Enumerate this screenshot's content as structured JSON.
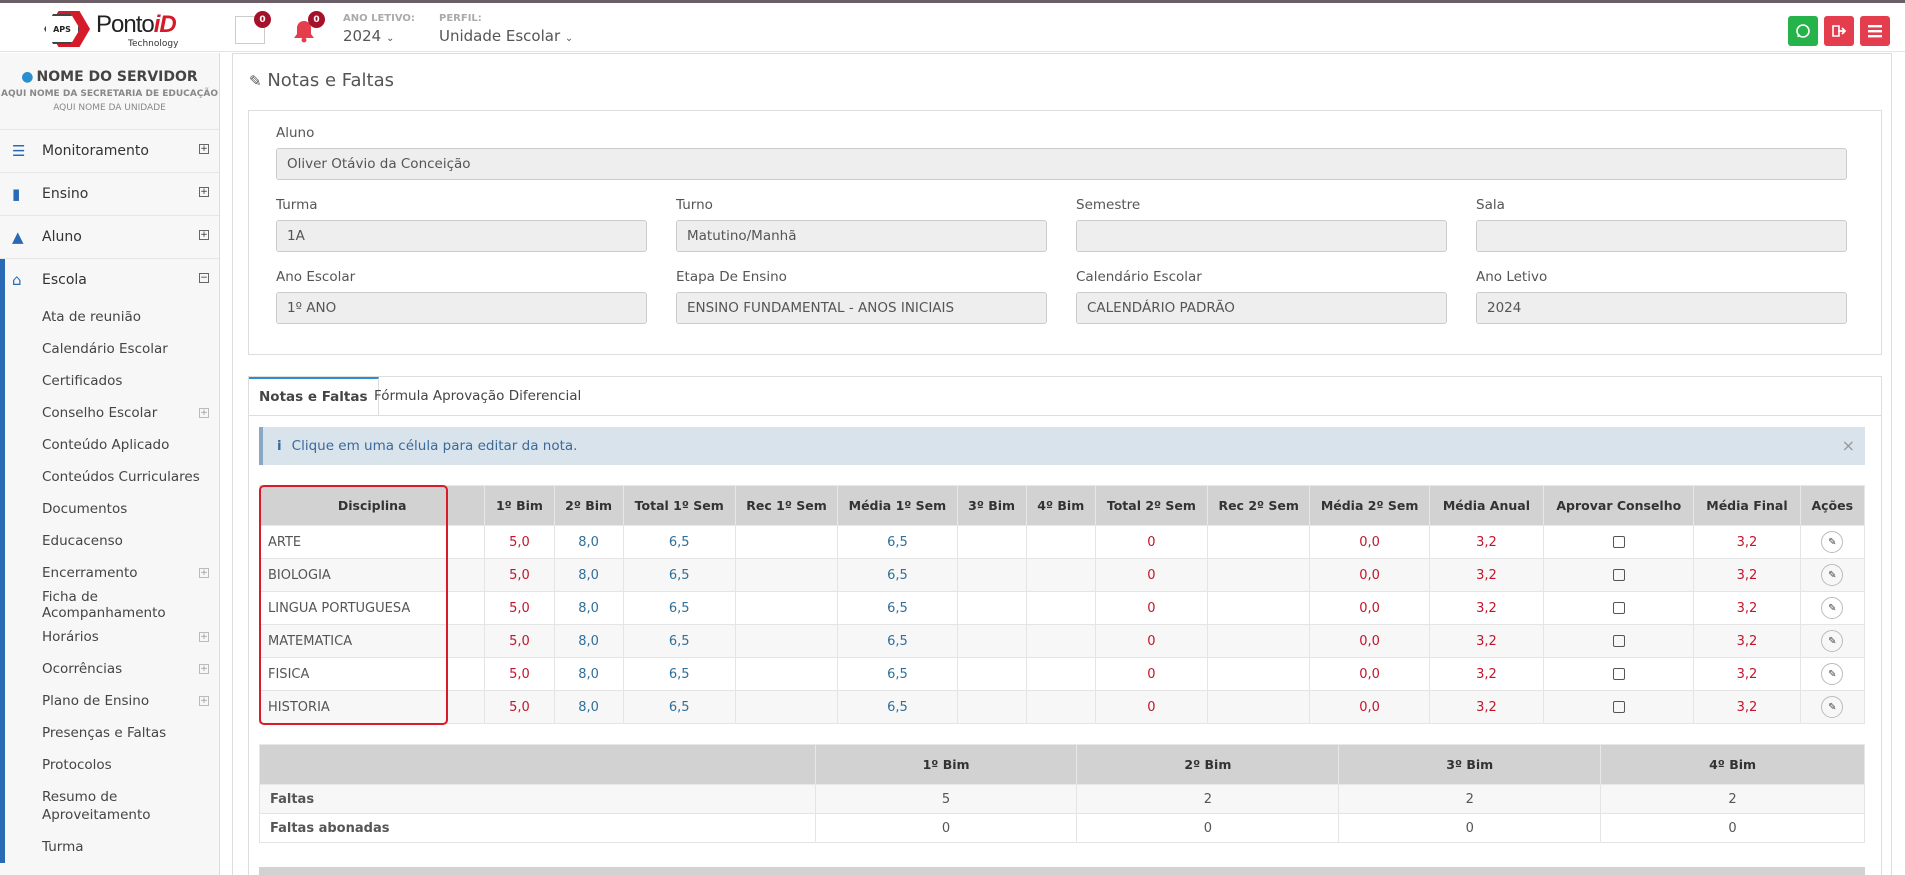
{
  "header": {
    "brand_pre": "Ponto",
    "brand_post": "iD",
    "brand_sub": "Technology",
    "logo_mark": "APS",
    "messages_count": "0",
    "notifications_count": "0",
    "ano_label": "ANO LETIVO:",
    "ano_value": "2024",
    "perfil_label": "PERFIL:",
    "perfil_value": "Unidade Escolar",
    "colors": {
      "whatsapp": "#25b34a",
      "logout": "#e33d4e",
      "menu": "#e33d4e"
    }
  },
  "sidebar": {
    "user_name": "NOME DO SERVIDOR",
    "secretaria": "AQUI NOME DA SECRETARIA DE EDUCAÇÃO",
    "unidade": "AQUI NOME DA UNIDADE",
    "menu": [
      {
        "label": "Monitoramento",
        "icon": "sliders-icon"
      },
      {
        "label": "Ensino",
        "icon": "book-icon"
      },
      {
        "label": "Aluno",
        "icon": "graduation-cap-icon"
      },
      {
        "label": "Escola",
        "icon": "bank-icon"
      }
    ],
    "submenu": [
      {
        "label": "Ata de reunião",
        "expand": false
      },
      {
        "label": "Calendário Escolar",
        "expand": false
      },
      {
        "label": "Certificados",
        "expand": false
      },
      {
        "label": "Conselho Escolar",
        "expand": true
      },
      {
        "label": "Conteúdo Aplicado",
        "expand": false
      },
      {
        "label": "Conteúdos Curriculares",
        "expand": false
      },
      {
        "label": "Documentos",
        "expand": false
      },
      {
        "label": "Educacenso",
        "expand": false
      },
      {
        "label": "Encerramento",
        "expand": true
      },
      {
        "label": "Ficha de Acompanhamento",
        "expand": false
      },
      {
        "label": "Horários",
        "expand": true
      },
      {
        "label": "Ocorrências",
        "expand": true
      },
      {
        "label": "Plano de Ensino",
        "expand": true
      },
      {
        "label": "Presenças e Faltas",
        "expand": false
      },
      {
        "label": "Protocolos",
        "expand": false
      },
      {
        "label": "Resumo de Aproveitamento",
        "expand": false
      },
      {
        "label": "Turma",
        "expand": false
      }
    ]
  },
  "page": {
    "title": "Notas e Faltas",
    "fields": {
      "aluno": {
        "label": "Aluno",
        "value": "Oliver Otávio da Conceição"
      },
      "turma": {
        "label": "Turma",
        "value": "1A"
      },
      "turno": {
        "label": "Turno",
        "value": "Matutino/Manhã"
      },
      "semestre": {
        "label": "Semestre",
        "value": ""
      },
      "sala": {
        "label": "Sala",
        "value": ""
      },
      "ano_escolar": {
        "label": "Ano Escolar",
        "value": "1º ANO"
      },
      "etapa": {
        "label": "Etapa De Ensino",
        "value": "ENSINO FUNDAMENTAL - ANOS INICIAIS"
      },
      "calendario": {
        "label": "Calendário Escolar",
        "value": "CALENDÁRIO PADRÃO"
      },
      "ano_letivo": {
        "label": "Ano Letivo",
        "value": "2024"
      }
    },
    "tabs": [
      "Notas e Faltas",
      "Fórmula Aprovação Diferencial"
    ],
    "alert": "Clique em uma célula para editar da nota.",
    "grades": {
      "columns": [
        "Disciplina",
        "1º Bim",
        "2º Bim",
        "Total 1º Sem",
        "Rec 1º Sem",
        "Média 1º Sem",
        "3º Bim",
        "4º Bim",
        "Total 2º Sem",
        "Rec 2º Sem",
        "Média 2º Sem",
        "Média Anual",
        "Aprovar Conselho",
        "Média Final",
        "Ações"
      ],
      "rows": [
        {
          "disc": "ARTE",
          "b1": "5,0",
          "b2": "8,0",
          "t1": "6,5",
          "r1": "",
          "m1": "6,5",
          "b3": "",
          "b4": "",
          "t2": "0",
          "r2": "",
          "m2": "0,0",
          "ma": "3,2",
          "mf": "3,2"
        },
        {
          "disc": "BIOLOGIA",
          "b1": "5,0",
          "b2": "8,0",
          "t1": "6,5",
          "r1": "",
          "m1": "6,5",
          "b3": "",
          "b4": "",
          "t2": "0",
          "r2": "",
          "m2": "0,0",
          "ma": "3,2",
          "mf": "3,2"
        },
        {
          "disc": "LINGUA PORTUGUESA",
          "b1": "5,0",
          "b2": "8,0",
          "t1": "6,5",
          "r1": "",
          "m1": "6,5",
          "b3": "",
          "b4": "",
          "t2": "0",
          "r2": "",
          "m2": "0,0",
          "ma": "3,2",
          "mf": "3,2"
        },
        {
          "disc": "MATEMATICA",
          "b1": "5,0",
          "b2": "8,0",
          "t1": "6,5",
          "r1": "",
          "m1": "6,5",
          "b3": "",
          "b4": "",
          "t2": "0",
          "r2": "",
          "m2": "0,0",
          "ma": "3,2",
          "mf": "3,2"
        },
        {
          "disc": "FISICA",
          "b1": "5,0",
          "b2": "8,0",
          "t1": "6,5",
          "r1": "",
          "m1": "6,5",
          "b3": "",
          "b4": "",
          "t2": "0",
          "r2": "",
          "m2": "0,0",
          "ma": "3,2",
          "mf": "3,2"
        },
        {
          "disc": "HISTORIA",
          "b1": "5,0",
          "b2": "8,0",
          "t1": "6,5",
          "r1": "",
          "m1": "6,5",
          "b3": "",
          "b4": "",
          "t2": "0",
          "r2": "",
          "m2": "0,0",
          "ma": "3,2",
          "mf": "3,2"
        }
      ]
    },
    "absences": {
      "columns": [
        "",
        "1º Bim",
        "2º Bim",
        "3º Bim",
        "4º Bim"
      ],
      "rows": [
        {
          "label": "Faltas",
          "values": [
            "5",
            "2",
            "2",
            "2"
          ]
        },
        {
          "label": "Faltas abonadas",
          "values": [
            "0",
            "0",
            "0",
            "0"
          ]
        }
      ]
    }
  }
}
